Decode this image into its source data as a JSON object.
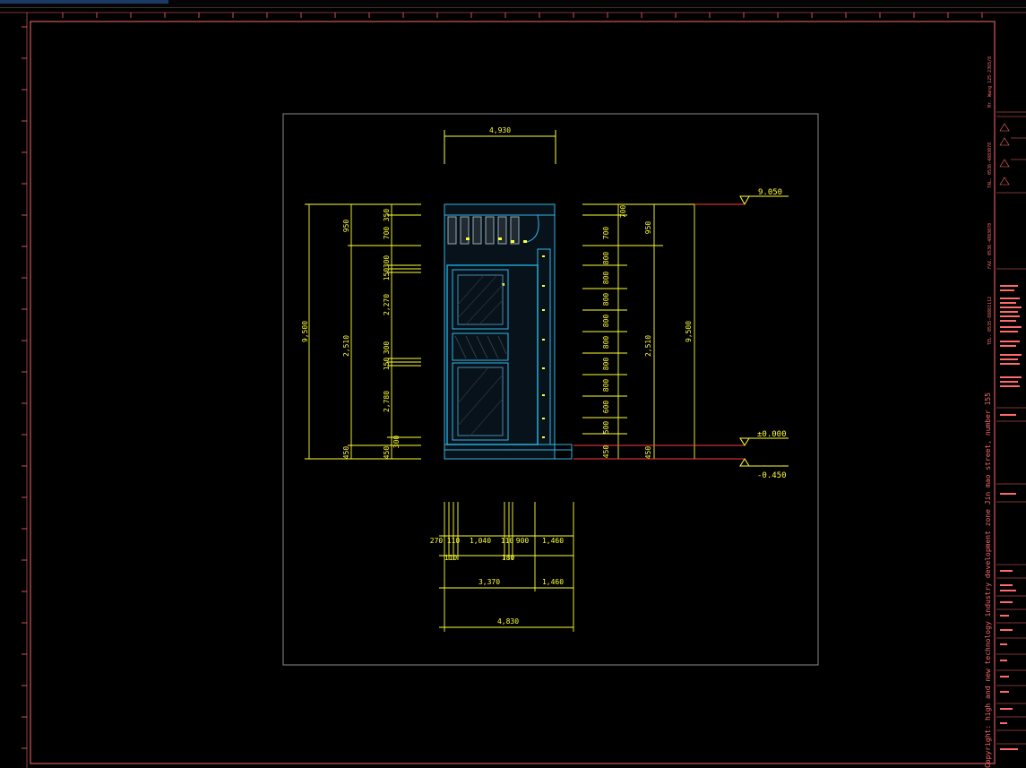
{
  "viewport": {
    "background": "#000000",
    "frame_color": "#ff6a6a",
    "dim_color": "#ffff33",
    "wall_color": "#33b5e5"
  },
  "elevation": {
    "top_width": "4,930",
    "levels": {
      "top": "9.050",
      "floor": "±0.000",
      "ground": "-0.450"
    },
    "left_dims": {
      "total": "9,500",
      "upper": "950",
      "middle": "2,510",
      "base": "450",
      "segments": [
        "350",
        "700",
        "300",
        "150",
        "2,270",
        "300",
        "150",
        "2,780",
        "300"
      ]
    },
    "right_dims": {
      "total": "9,500",
      "upper": "950",
      "middle": "2,510",
      "base": "450",
      "segments": [
        "700",
        "700",
        "800",
        "800",
        "800",
        "800",
        "800",
        "800",
        "800",
        "600",
        "500",
        "450"
      ]
    },
    "bottom_dims": {
      "row1": [
        "270",
        "110",
        "1,040",
        "110",
        "900",
        "1,460"
      ],
      "row2": [
        "110",
        "180"
      ],
      "row3": [
        "3,370",
        "1,460"
      ],
      "total": "4,830"
    }
  },
  "title_block": {
    "small_texts": [
      "Mr. Wang 125-2365/8",
      "TAL. 0536-4883078",
      "FAX. 0536-4883078",
      "TEL. 0535-88861112"
    ],
    "copyright": "Copyright: high and new technology industry development zone Jin mao street, number 155"
  }
}
